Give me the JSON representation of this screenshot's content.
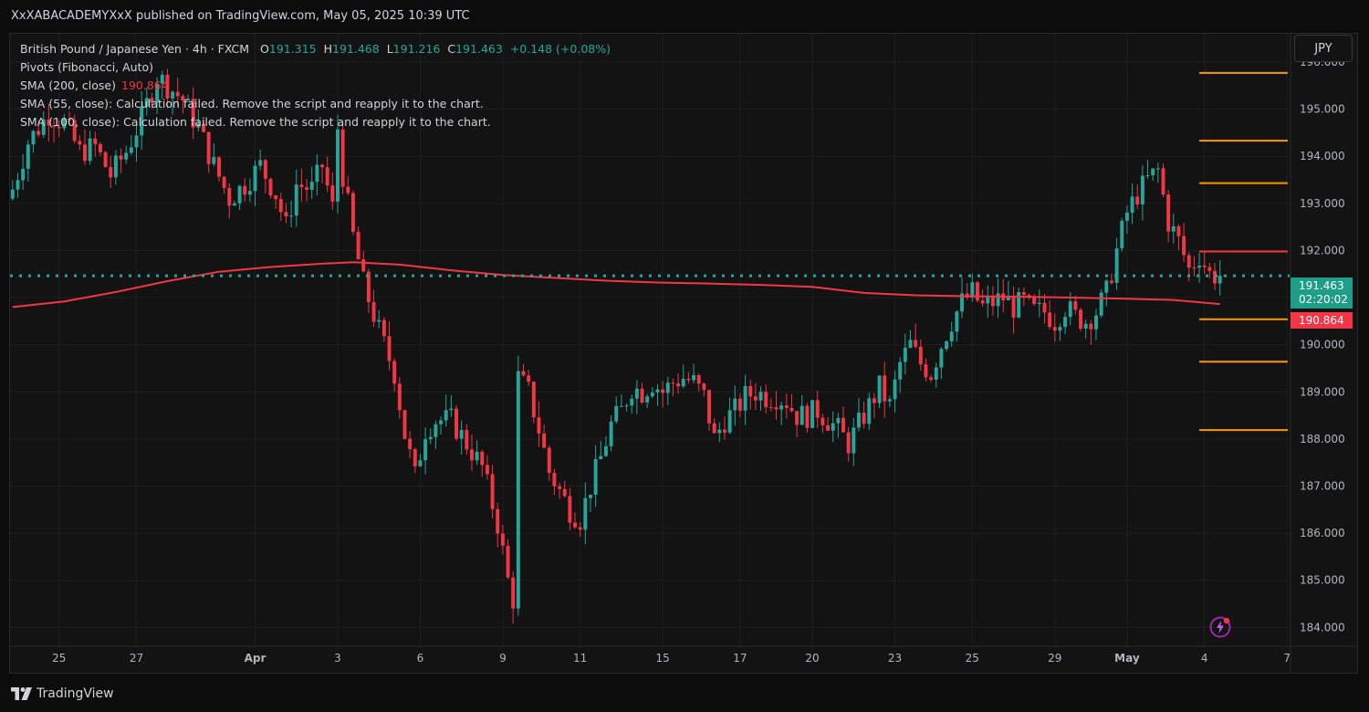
{
  "header": {
    "published_by": "XxXABACADEMYXxX published on TradingView.com, May 05, 2025 10:39 UTC"
  },
  "legend": {
    "symbol": "British Pound / Japanese Yen · 4h · FXCM",
    "open_label": "O",
    "open": "191.315",
    "high_label": "H",
    "high": "191.468",
    "low_label": "L",
    "low": "191.216",
    "close_label": "C",
    "close": "191.463",
    "change": "+0.148 (+0.08%)",
    "pivots": "Pivots (Fibonacci, Auto)",
    "sma200_label": "SMA (200, close)",
    "sma200_value": "190.864",
    "sma55_label": "SMA (55, close): Calculation failed. Remove the script and reapply it to the chart.",
    "sma100_label": "SMA (100, close): Calculation failed. Remove the script and reapply it to the chart."
  },
  "currency_button": "JPY",
  "price_tags": {
    "last_price": "191.463",
    "countdown": "02:20:02",
    "sma_value": "190.864"
  },
  "footer": {
    "brand": "TradingView"
  },
  "colors": {
    "up": "#26a69a",
    "down": "#f23645",
    "sma": "#f23645",
    "pivot": "#ff9800",
    "background": "#131313",
    "grid": "#1f1f1f",
    "last_price_line": "#26a69a"
  },
  "icons": {
    "alert": "lightning-alert-icon",
    "logo": "tradingview-logo-icon"
  },
  "chart_data": {
    "type": "candlestick",
    "ylim": [
      183.6,
      196.6
    ],
    "y_ticks": [
      "196.000",
      "195.000",
      "194.000",
      "193.000",
      "192.000",
      "191.000",
      "190.000",
      "189.000",
      "188.000",
      "187.000",
      "186.000",
      "185.000",
      "184.000"
    ],
    "x_ticks": [
      {
        "label": "25",
        "bar": 9
      },
      {
        "label": "27",
        "bar": 24
      },
      {
        "label": "Apr",
        "bar": 47,
        "bold": true
      },
      {
        "label": "3",
        "bar": 63
      },
      {
        "label": "6",
        "bar": 79
      },
      {
        "label": "9",
        "bar": 95
      },
      {
        "label": "11",
        "bar": 110
      },
      {
        "label": "15",
        "bar": 126
      },
      {
        "label": "17",
        "bar": 141
      },
      {
        "label": "20",
        "bar": 155
      },
      {
        "label": "23",
        "bar": 171
      },
      {
        "label": "25",
        "bar": 186
      },
      {
        "label": "29",
        "bar": 202
      },
      {
        "label": "May",
        "bar": 216,
        "bold": true
      },
      {
        "label": "4",
        "bar": 231
      },
      {
        "label": "7",
        "bar": 247
      }
    ],
    "total_bars": 248,
    "last_price": 191.463,
    "sma200_last": 190.864,
    "sma200": [
      [
        0,
        190.8
      ],
      [
        10,
        190.92
      ],
      [
        20,
        191.12
      ],
      [
        30,
        191.35
      ],
      [
        40,
        191.55
      ],
      [
        50,
        191.65
      ],
      [
        60,
        191.72
      ],
      [
        66,
        191.75
      ],
      [
        75,
        191.7
      ],
      [
        85,
        191.58
      ],
      [
        95,
        191.48
      ],
      [
        105,
        191.42
      ],
      [
        115,
        191.36
      ],
      [
        125,
        191.32
      ],
      [
        135,
        191.3
      ],
      [
        145,
        191.27
      ],
      [
        155,
        191.23
      ],
      [
        165,
        191.1
      ],
      [
        175,
        191.05
      ],
      [
        185,
        191.03
      ],
      [
        195,
        191.02
      ],
      [
        205,
        191.0
      ],
      [
        215,
        190.98
      ],
      [
        225,
        190.95
      ],
      [
        234,
        190.864
      ]
    ],
    "pivot_levels": [
      {
        "value": 195.77,
        "color": "#ff9800"
      },
      {
        "value": 194.33,
        "color": "#ff9800"
      },
      {
        "value": 193.43,
        "color": "#ff9800"
      },
      {
        "value": 191.98,
        "color": "#f23645"
      },
      {
        "value": 190.54,
        "color": "#ff9800"
      },
      {
        "value": 189.64,
        "color": "#ff9800"
      },
      {
        "value": 188.19,
        "color": "#ff9800"
      }
    ],
    "pivot_start_bar": 230,
    "close_path": [
      [
        0,
        193.3
      ],
      [
        3,
        194.3
      ],
      [
        7,
        194.9
      ],
      [
        10,
        194.7
      ],
      [
        13,
        194.1
      ],
      [
        16,
        194.2
      ],
      [
        19,
        193.6
      ],
      [
        22,
        194.1
      ],
      [
        25,
        194.8
      ],
      [
        28,
        195.7
      ],
      [
        30,
        195.5
      ],
      [
        33,
        195.2
      ],
      [
        36,
        194.6
      ],
      [
        39,
        193.8
      ],
      [
        42,
        193.1
      ],
      [
        45,
        193.4
      ],
      [
        48,
        193.8
      ],
      [
        51,
        193.2
      ],
      [
        53,
        192.5
      ],
      [
        55,
        193.4
      ],
      [
        58,
        193.3
      ],
      [
        60,
        193.8
      ],
      [
        62,
        192.9
      ],
      [
        63,
        194.6
      ],
      [
        64,
        193.6
      ],
      [
        66,
        192.3
      ],
      [
        68,
        191.3
      ],
      [
        71,
        190.3
      ],
      [
        74,
        189.4
      ],
      [
        76,
        188.1
      ],
      [
        78,
        187.2
      ],
      [
        80,
        188.2
      ],
      [
        82,
        188.4
      ],
      [
        85,
        188.4
      ],
      [
        88,
        187.9
      ],
      [
        91,
        187.4
      ],
      [
        94,
        186.2
      ],
      [
        96,
        185.0
      ],
      [
        97,
        184.6
      ],
      [
        98,
        189.3
      ],
      [
        100,
        189.0
      ],
      [
        102,
        188.2
      ],
      [
        104,
        187.3
      ],
      [
        106,
        186.9
      ],
      [
        108,
        186.5
      ],
      [
        110,
        186.3
      ],
      [
        112,
        187.0
      ],
      [
        114,
        187.6
      ],
      [
        116,
        188.3
      ],
      [
        118,
        188.6
      ],
      [
        120,
        189.1
      ],
      [
        122,
        189.0
      ],
      [
        124,
        189.2
      ],
      [
        126,
        189.0
      ],
      [
        128,
        189.2
      ],
      [
        130,
        189.3
      ],
      [
        132,
        189.2
      ],
      [
        134,
        188.9
      ],
      [
        136,
        188.0
      ],
      [
        138,
        188.4
      ],
      [
        140,
        188.6
      ],
      [
        142,
        188.9
      ],
      [
        144,
        189.0
      ],
      [
        146,
        188.9
      ],
      [
        148,
        188.9
      ],
      [
        150,
        188.8
      ],
      [
        152,
        188.5
      ],
      [
        154,
        188.5
      ],
      [
        156,
        188.6
      ],
      [
        158,
        188.4
      ],
      [
        160,
        188.2
      ],
      [
        162,
        187.9
      ],
      [
        164,
        188.3
      ],
      [
        166,
        188.7
      ],
      [
        168,
        189.1
      ],
      [
        170,
        188.7
      ],
      [
        172,
        189.6
      ],
      [
        174,
        190.0
      ],
      [
        176,
        189.6
      ],
      [
        178,
        189.4
      ],
      [
        180,
        190.0
      ],
      [
        182,
        190.5
      ],
      [
        184,
        190.9
      ],
      [
        186,
        191.1
      ],
      [
        188,
        190.8
      ],
      [
        190,
        190.9
      ],
      [
        192,
        191.0
      ],
      [
        194,
        190.8
      ],
      [
        196,
        190.9
      ],
      [
        198,
        190.7
      ],
      [
        200,
        190.7
      ],
      [
        202,
        190.5
      ],
      [
        204,
        190.8
      ],
      [
        206,
        190.6
      ],
      [
        208,
        190.5
      ],
      [
        210,
        190.7
      ],
      [
        212,
        191.1
      ],
      [
        214,
        192.0
      ],
      [
        216,
        192.8
      ],
      [
        218,
        193.2
      ],
      [
        220,
        193.5
      ],
      [
        222,
        193.7
      ],
      [
        224,
        192.6
      ],
      [
        226,
        192.2
      ],
      [
        228,
        191.6
      ],
      [
        230,
        191.9
      ],
      [
        232,
        191.5
      ],
      [
        234,
        191.463
      ]
    ]
  }
}
